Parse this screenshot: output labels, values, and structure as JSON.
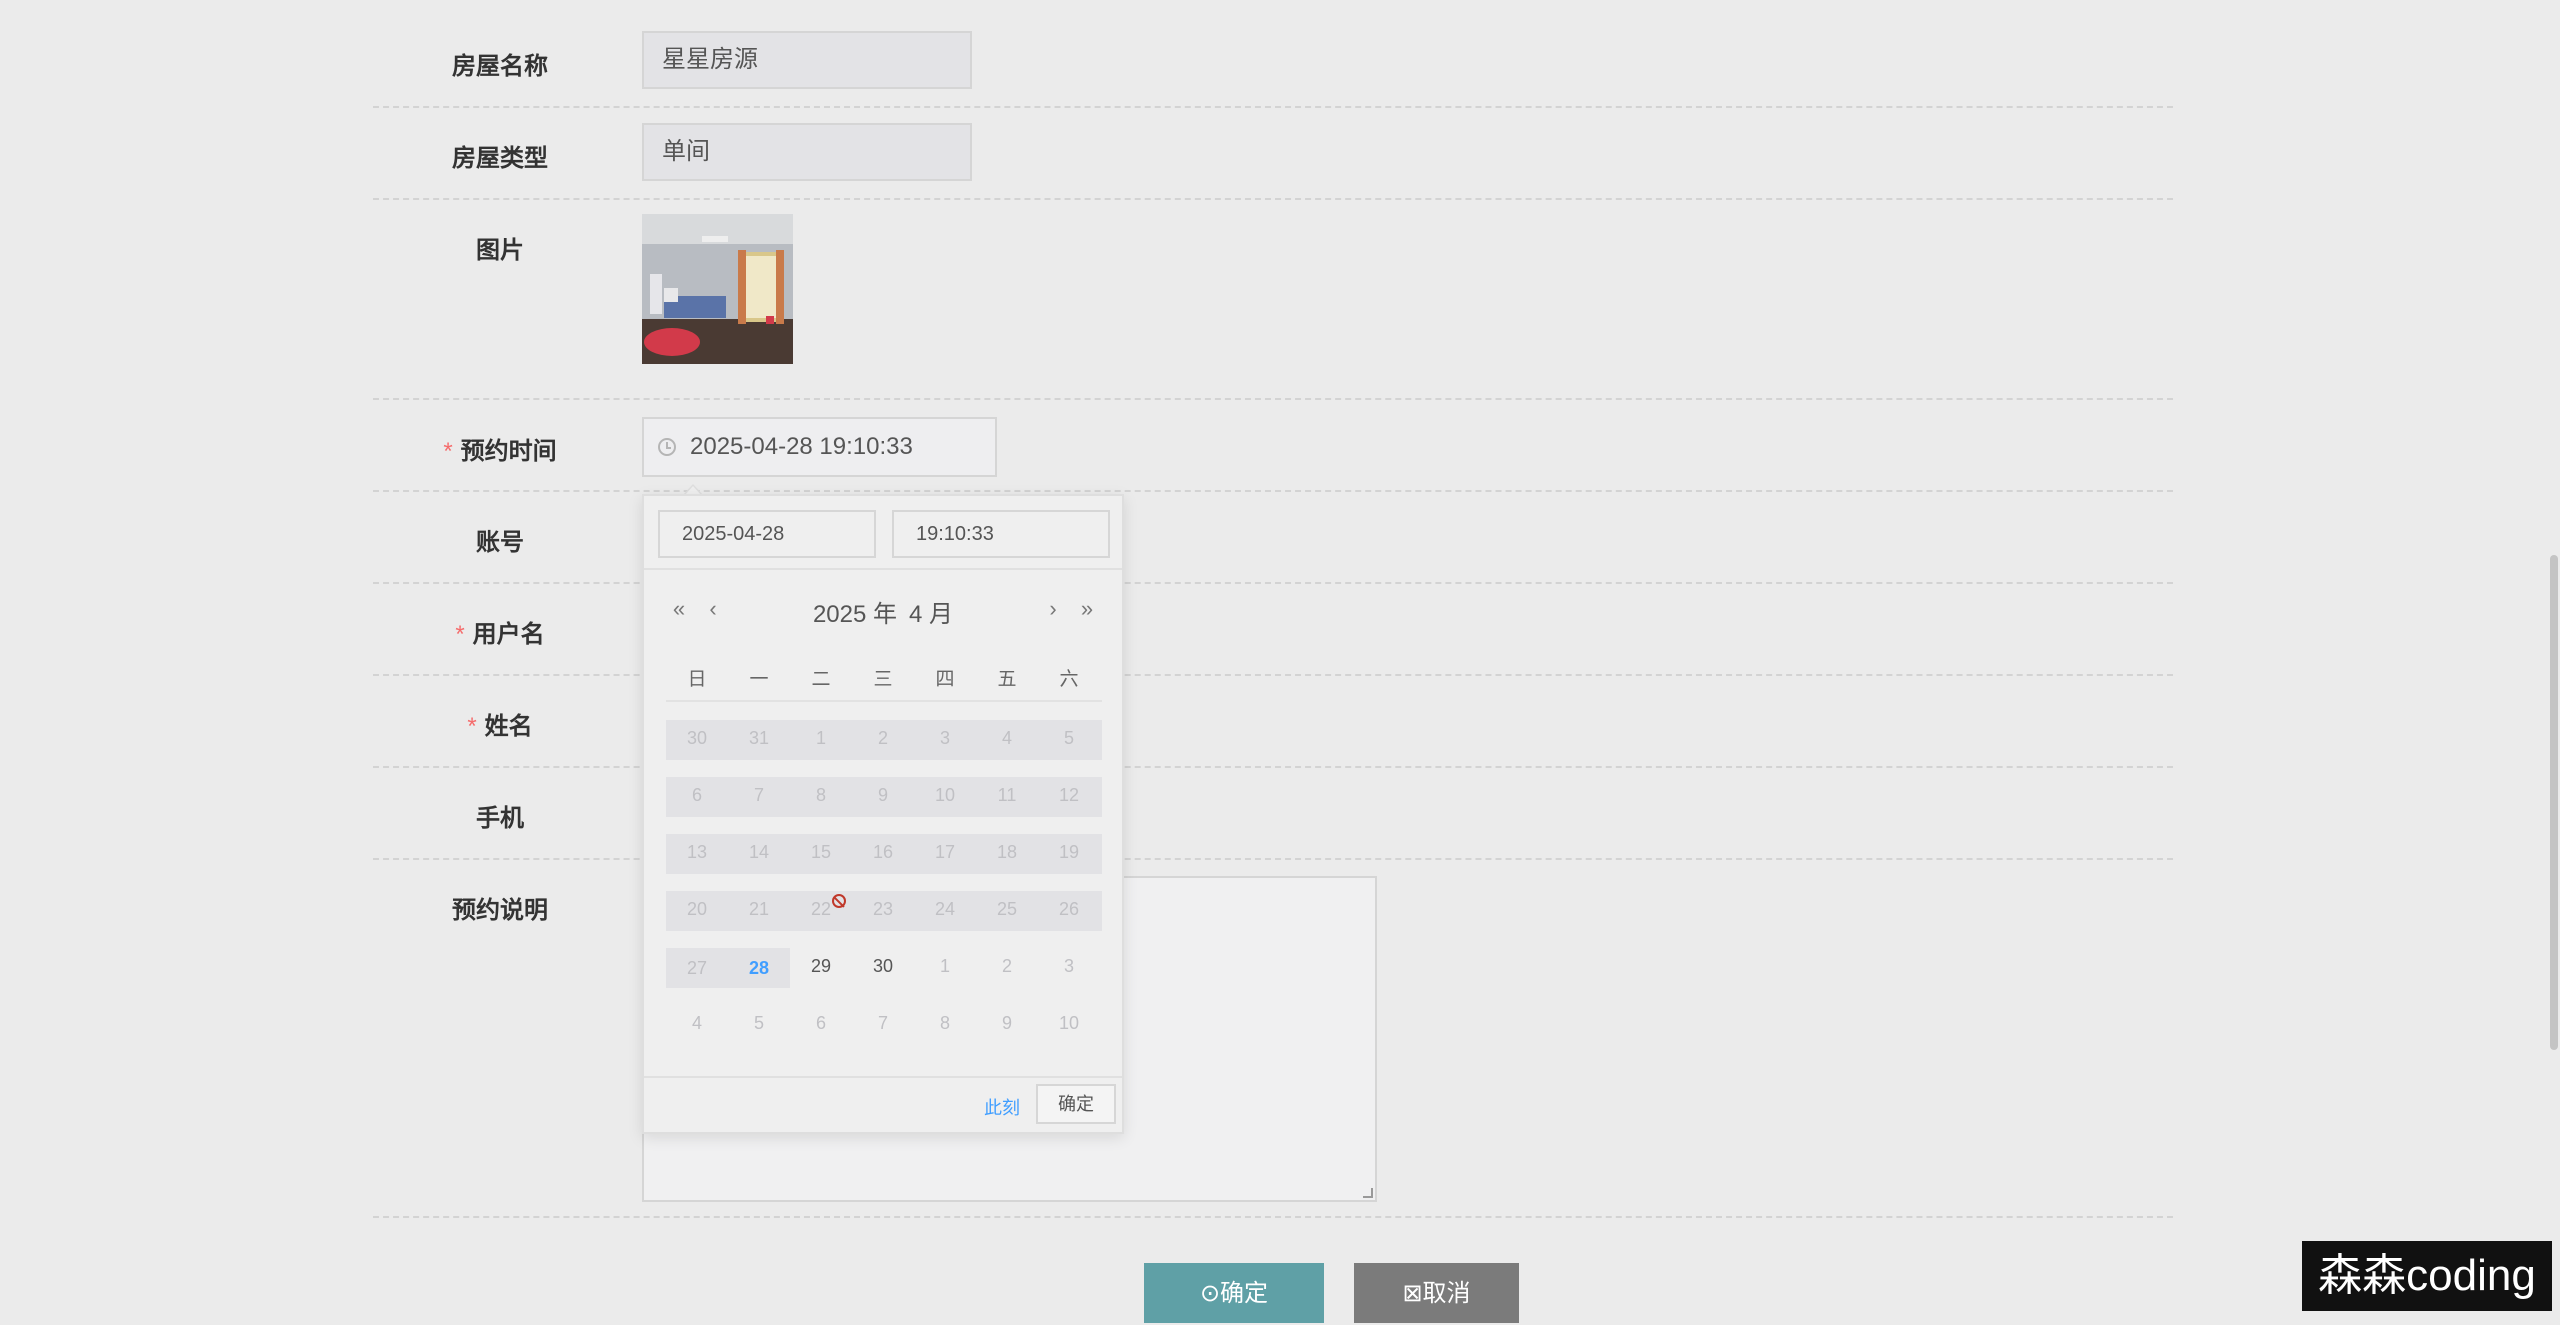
{
  "form": {
    "house_name": {
      "label": "房屋名称",
      "value": "星星房源"
    },
    "house_type": {
      "label": "房屋类型",
      "value": "单间"
    },
    "image": {
      "label": "图片"
    },
    "booking_time": {
      "required_mark": "*",
      "label": "预约时间",
      "value": "2025-04-28 19:10:33"
    },
    "account": {
      "label": "账号"
    },
    "username": {
      "required_mark": "*",
      "label": "用户名"
    },
    "fullname": {
      "required_mark": "*",
      "label": "姓名"
    },
    "phone": {
      "label": "手机"
    },
    "booking_note": {
      "label": "预约说明"
    }
  },
  "picker": {
    "date_value": "2025-04-28",
    "time_value": "19:10:33",
    "prev_year": "«",
    "prev_month": "‹",
    "next_month": "›",
    "next_year": "»",
    "year_label": "2025 年",
    "month_label": "4 月",
    "weekdays": [
      "日",
      "一",
      "二",
      "三",
      "四",
      "五",
      "六"
    ],
    "weeks": [
      [
        "30",
        "31",
        "1",
        "2",
        "3",
        "4",
        "5"
      ],
      [
        "6",
        "7",
        "8",
        "9",
        "10",
        "11",
        "12"
      ],
      [
        "13",
        "14",
        "15",
        "16",
        "17",
        "18",
        "19"
      ],
      [
        "20",
        "21",
        "22",
        "23",
        "24",
        "25",
        "26"
      ],
      [
        "27",
        "28",
        "29",
        "30",
        "1",
        "2",
        "3"
      ],
      [
        "4",
        "5",
        "6",
        "7",
        "8",
        "9",
        "10"
      ]
    ],
    "today": "28",
    "now_label": "此刻",
    "confirm_label": "确定"
  },
  "actions": {
    "confirm_label": "确定",
    "cancel_label": "取消"
  },
  "watermark": "森森coding",
  "colors": {
    "accent": "#409eff",
    "required": "#f56c6c",
    "confirm_button": "#5fa0a6",
    "cancel_button": "#7b7b7b"
  }
}
